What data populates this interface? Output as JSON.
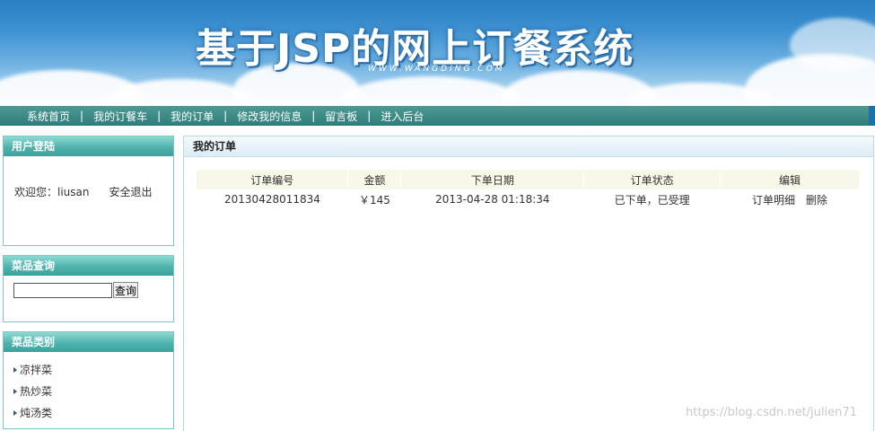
{
  "banner": {
    "title": "基于JSP的网上订餐系统",
    "subtitle": "WWW.WANGDING.COM"
  },
  "nav": {
    "items": [
      {
        "label": "系统首页"
      },
      {
        "label": "我的订餐车"
      },
      {
        "label": "我的订单"
      },
      {
        "label": "修改我的信息"
      },
      {
        "label": "留言板"
      },
      {
        "label": "进入后台"
      }
    ],
    "separator": "|"
  },
  "login_box": {
    "title": "用户登陆",
    "welcome": "欢迎您：liusan",
    "logout_label": "安全退出"
  },
  "search_box": {
    "title": "菜品查询",
    "input_value": "",
    "button_label": "查询"
  },
  "category_box": {
    "title": "菜品类别",
    "items": [
      {
        "label": "凉拌菜"
      },
      {
        "label": "热炒菜"
      },
      {
        "label": "炖汤类"
      }
    ]
  },
  "orders_panel": {
    "title": "我的订单",
    "columns": [
      "订单编号",
      "金额",
      "下单日期",
      "订单状态",
      "编辑"
    ],
    "rows": [
      {
        "order_no": "20130428011834",
        "amount": "￥145",
        "date": "2013-04-28 01:18:34",
        "status": "已下单，已受理",
        "detail_label": "订单明细",
        "delete_label": "删除"
      }
    ]
  },
  "watermark": "https://blog.csdn.net/julien71",
  "colors": {
    "nav_bg": "#2f7d78",
    "box_header": "#4fb3ad",
    "box_border": "#7fc6c2",
    "table_header_bg": "#f7f7ea"
  }
}
